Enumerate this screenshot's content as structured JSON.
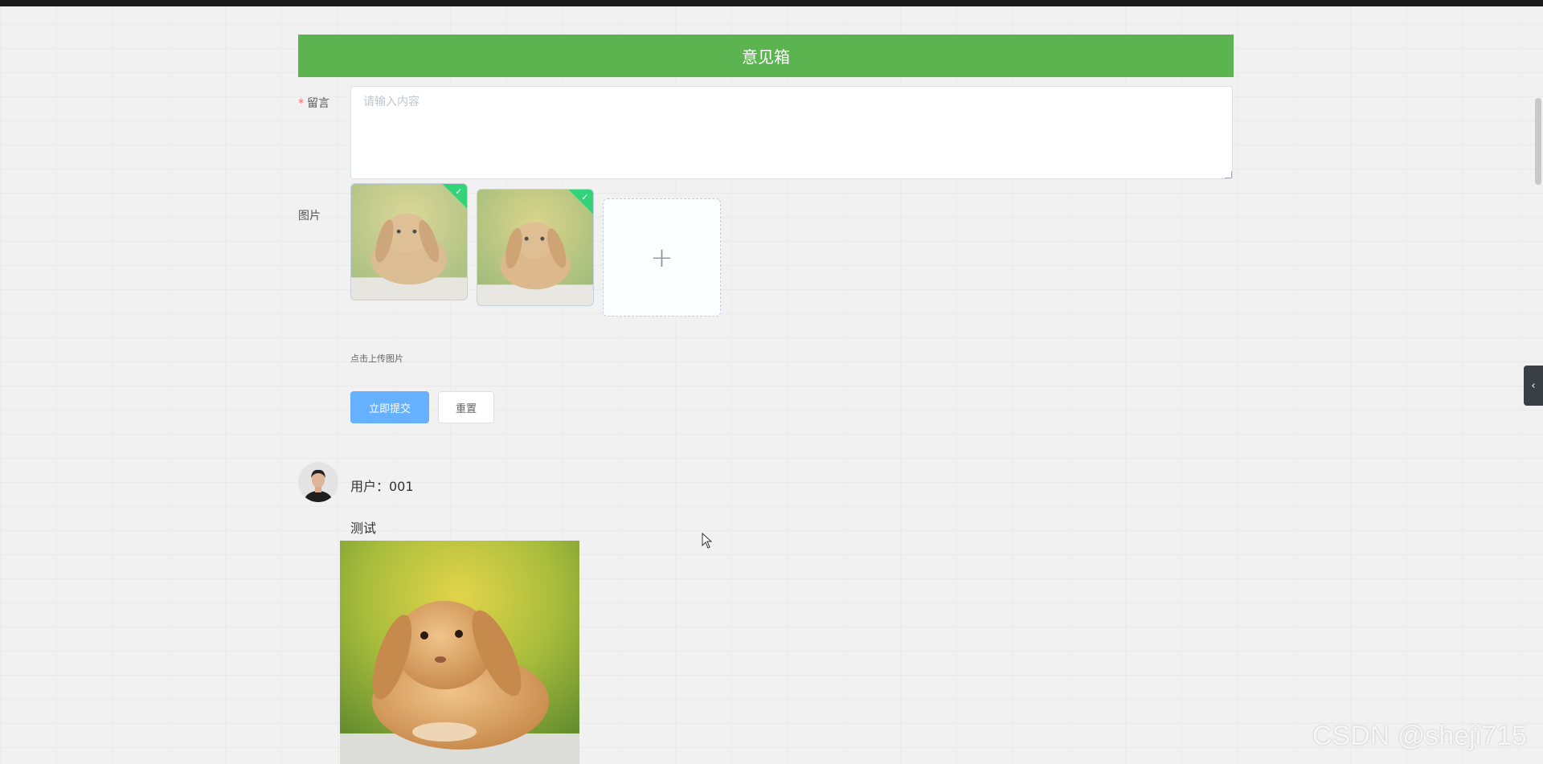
{
  "header": {
    "title": "意见箱"
  },
  "form": {
    "message_label": "留言",
    "required_mark": "*",
    "message_placeholder": "请输入内容",
    "message_value": "",
    "image_label": "图片",
    "upload_tip": "点击上传图片",
    "upload_plus": "+",
    "uploaded_images": [
      {
        "icon": "rabbit-image",
        "status": "uploaded"
      },
      {
        "icon": "rabbit-image",
        "status": "uploaded"
      }
    ],
    "check_glyph": "✓",
    "submit_label": "立即提交",
    "reset_label": "重置"
  },
  "comments": [
    {
      "user": "用户：001",
      "content": "测试",
      "avatar_icon": "user-avatar",
      "image_icon": "rabbit-image"
    }
  ],
  "side_tab": {
    "glyph": "‹"
  },
  "watermark": "CSDN @sheji715",
  "colors": {
    "banner": "#5cb451",
    "primary_button": "#66b1ff",
    "success_check": "#13ce66",
    "required": "#f56c6c"
  }
}
